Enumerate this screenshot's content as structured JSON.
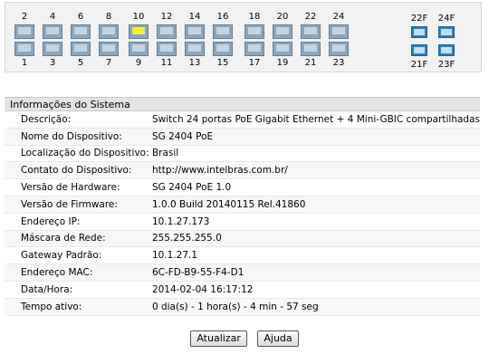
{
  "ports": {
    "top": [
      "2",
      "4",
      "6",
      "8",
      "10",
      "12",
      "14",
      "16",
      "18",
      "20",
      "22",
      "24"
    ],
    "bottom": [
      "1",
      "3",
      "5",
      "7",
      "9",
      "11",
      "13",
      "15",
      "17",
      "19",
      "21",
      "23"
    ],
    "active_port": "10",
    "sfp_top": [
      "22F",
      "24F"
    ],
    "sfp_bottom": [
      "21F",
      "23F"
    ]
  },
  "section_title": "Informações do Sistema",
  "info": [
    {
      "key": "Descrição:",
      "value": "Switch 24 portas PoE Gigabit Ethernet + 4 Mini-GBIC compartilhadas"
    },
    {
      "key": "Nome do Dispositivo:",
      "value": "SG 2404 PoE"
    },
    {
      "key": "Localização do Dispositivo:",
      "value": "Brasil"
    },
    {
      "key": "Contato do Dispositivo:",
      "value": "http://www.intelbras.com.br/"
    },
    {
      "key": "Versão de Hardware:",
      "value": "SG 2404 PoE 1.0"
    },
    {
      "key": "Versão de Firmware:",
      "value": "1.0.0 Build 20140115 Rel.41860"
    },
    {
      "key": "Endereço IP:",
      "value": "10.1.27.173"
    },
    {
      "key": "Máscara de Rede:",
      "value": "255.255.255.0"
    },
    {
      "key": "Gateway Padrão:",
      "value": "10.1.27.1"
    },
    {
      "key": "Endereço MAC:",
      "value": "6C-FD-B9-55-F4-D1"
    },
    {
      "key": "Data/Hora:",
      "value": "2014-02-04 16:17:12"
    },
    {
      "key": "Tempo ativo:",
      "value": "0 dia(s) - 1 hora(s) - 4 min - 57 seg"
    }
  ],
  "buttons": {
    "refresh": "Atualizar",
    "help": "Ajuda"
  },
  "colors": {
    "port_active": "#f4ef33",
    "port": "#8ba6bd",
    "sfp": "#2e7fbd"
  }
}
